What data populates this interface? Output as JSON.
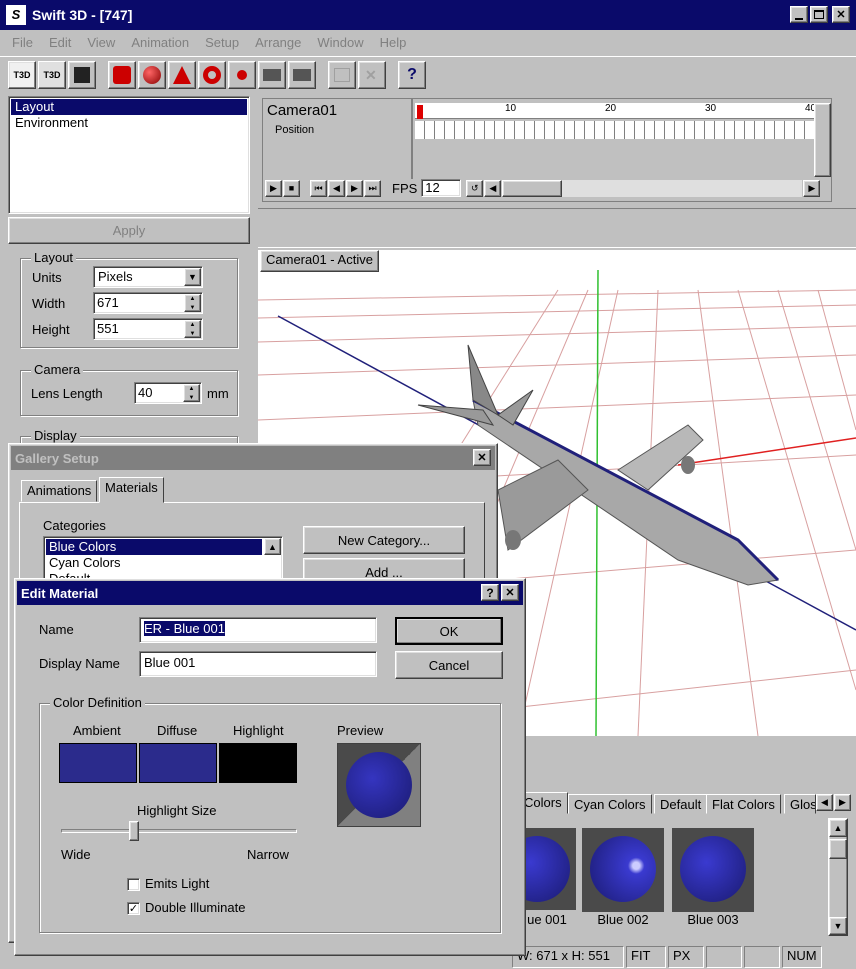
{
  "window": {
    "title": "Swift 3D - [747]"
  },
  "menu": [
    "File",
    "Edit",
    "View",
    "Animation",
    "Setup",
    "Arrange",
    "Window",
    "Help"
  ],
  "toolbar": {
    "t3d": "T3D",
    "t3d2": "T3D"
  },
  "left_panel": {
    "list": [
      "Layout",
      "Environment"
    ],
    "apply": "Apply",
    "layout_group": "Layout",
    "units_label": "Units",
    "units_value": "Pixels",
    "width_label": "Width",
    "width_value": "671",
    "height_label": "Height",
    "height_value": "551",
    "camera_group": "Camera",
    "lens_label": "Lens Length",
    "lens_value": "40",
    "lens_unit": "mm",
    "display_group": "Display"
  },
  "timeline": {
    "camera": "Camera01",
    "position": "Position",
    "ticks": [
      "1",
      "10",
      "20",
      "30",
      "40"
    ],
    "fps_label": "FPS",
    "fps_value": "12"
  },
  "viewport": {
    "label": "Camera01 - Active"
  },
  "gallery": {
    "title": "Gallery Setup",
    "close": "✕",
    "tabs": [
      "Animations",
      "Materials"
    ],
    "categories_label": "Categories",
    "categories": [
      "Blue Colors",
      "Cyan Colors",
      "Default"
    ],
    "new_category": "New Category...",
    "add": "Add ..."
  },
  "edit_material": {
    "title": "Edit Material",
    "help": "?",
    "close": "✕",
    "name_label": "Name",
    "name_value": "ER - Blue 001",
    "display_label": "Display Name",
    "display_value": "Blue 001",
    "ok": "OK",
    "cancel": "Cancel",
    "color_def": "Color Definition",
    "ambient": "Ambient",
    "diffuse": "Diffuse",
    "highlight": "Highlight",
    "preview": "Preview",
    "highlight_size": "Highlight Size",
    "wide": "Wide",
    "narrow": "Narrow",
    "highlight_size_level": 0.3,
    "emits_light": "Emits Light",
    "emits_light_checked": false,
    "double_illuminate": "Double Illuminate",
    "double_illuminate_checked": true,
    "colors": {
      "ambient": "#2b2b8c",
      "diffuse": "#2b2b8c",
      "highlight": "#000000"
    }
  },
  "gallery_panel": {
    "tabs": [
      "Colors",
      "Cyan Colors",
      "Default",
      "Flat Colors",
      "Glos"
    ],
    "items": [
      "ue 001",
      "Blue 002",
      "Blue 003"
    ]
  },
  "status": {
    "size": "W: 671 x H: 551",
    "fit": "FIT",
    "px": "PX",
    "num": "NUM"
  },
  "colors": {
    "title_bar": "#0a0a6a",
    "selection": "#0a0a6a",
    "grid": "#c06060",
    "sphere": "#2b2bb0"
  }
}
